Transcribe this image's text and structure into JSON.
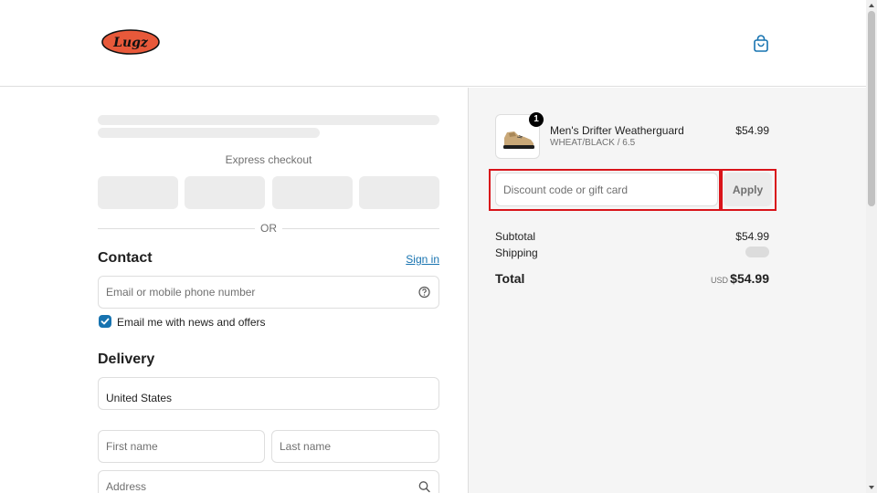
{
  "header": {
    "logo_text": "Lugz"
  },
  "express": {
    "label": "Express checkout",
    "or": "OR"
  },
  "contact": {
    "heading": "Contact",
    "sign_in": "Sign in",
    "email_placeholder": "Email or mobile phone number",
    "newsletter_label": "Email me with news and offers",
    "newsletter_checked": true
  },
  "delivery": {
    "heading": "Delivery",
    "country": "United States",
    "first_name_placeholder": "First name",
    "last_name_placeholder": "Last name",
    "address_placeholder": "Address"
  },
  "summary": {
    "item": {
      "quantity": "1",
      "name": "Men's Drifter Weatherguard",
      "variant": "WHEAT/BLACK / 6.5",
      "price": "$54.99"
    },
    "discount_placeholder": "Discount code or gift card",
    "apply_label": "Apply",
    "subtotal_label": "Subtotal",
    "subtotal_value": "$54.99",
    "shipping_label": "Shipping",
    "total_label": "Total",
    "total_currency": "USD",
    "total_value": "$54.99"
  },
  "colors": {
    "accent": "#1773b0",
    "highlight": "#d9141a",
    "logo_fill": "#e8593a"
  }
}
